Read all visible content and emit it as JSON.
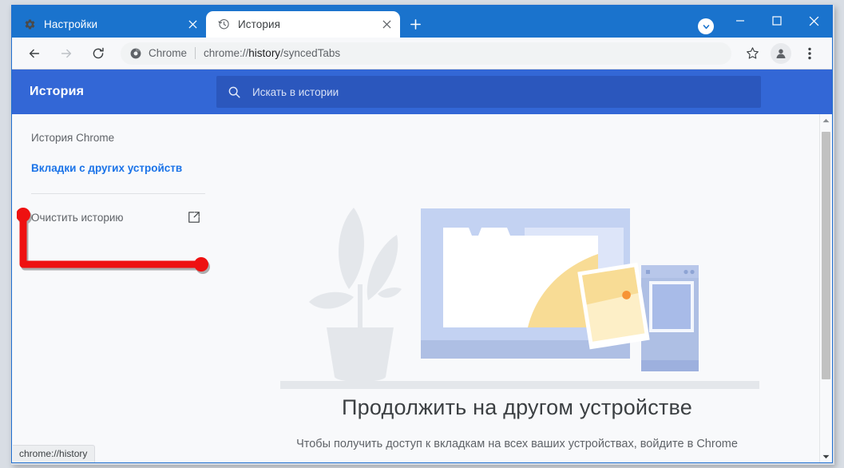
{
  "window": {
    "minimize_label": "minimize",
    "maximize_label": "maximize",
    "close_label": "close",
    "tab_search_label": "tab-search"
  },
  "tabs": [
    {
      "title": "Настройки",
      "favicon": "gear-icon",
      "active": false,
      "close_label": "×"
    },
    {
      "title": "История",
      "favicon": "history-clock-icon",
      "active": true,
      "close_label": "×"
    }
  ],
  "new_tab_label": "+",
  "toolbar": {
    "back_label": "back",
    "forward_label": "forward",
    "reload_label": "reload",
    "omnibox": {
      "favicon": "chrome-logo-icon",
      "scheme_label": "Chrome",
      "url_prefix": "chrome://",
      "url_bold": "history",
      "url_suffix": "/syncedTabs",
      "full_url": "chrome://history/syncedTabs"
    },
    "bookmark_label": "star-icon",
    "profile_label": "profile-avatar",
    "menu_label": "three-dot-menu"
  },
  "history_page": {
    "title": "История",
    "search": {
      "placeholder": "Искать в истории",
      "value": "",
      "icon": "search-icon"
    },
    "sidebar": [
      {
        "label": "История Chrome",
        "selected": false,
        "external": false
      },
      {
        "label": "Вкладки с других устройств",
        "selected": true,
        "external": false
      },
      {
        "label": "Очистить историю",
        "selected": false,
        "external": true,
        "icon": "external-link-icon"
      }
    ],
    "empty_state": {
      "title": "Продолжить на другом устройстве",
      "subtitle": "Чтобы получить доступ к вкладкам на всех ваших устройствах, войдите в Chrome",
      "illustration": "synced-devices-illustration"
    }
  },
  "status_bubble": {
    "text": "chrome://history"
  },
  "annotation": {
    "shape": "l-bracket-callout",
    "color": "#ee1111",
    "target": "Очистить историю"
  },
  "colors": {
    "tabstrip_blue": "#1a73cd",
    "header_blue": "#3367d6",
    "search_blue": "#2b57bd",
    "link_blue": "#1a73e8",
    "page_bg": "#f8f9fb",
    "annotation_red": "#ee1111"
  }
}
